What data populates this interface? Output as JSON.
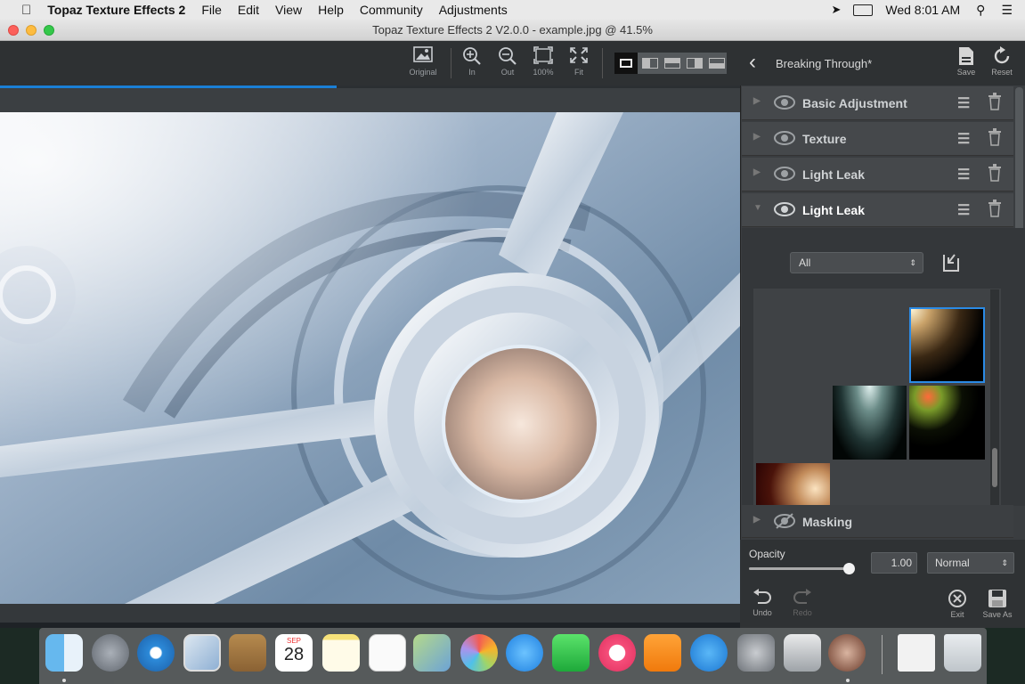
{
  "menubar": {
    "app": "Topaz Texture Effects 2",
    "items": [
      "File",
      "Edit",
      "View",
      "Help",
      "Community",
      "Adjustments"
    ],
    "clock": "Wed 8:01 AM"
  },
  "window": {
    "title": "Topaz Texture Effects 2 V2.0.0 - example.jpg @ 41.5%"
  },
  "toolbar": {
    "original": "Original",
    "zoom_in": "In",
    "zoom_out": "Out",
    "zoom_100": "100%",
    "fit": "Fit",
    "progress": 0.455
  },
  "panel": {
    "preset_title": "Breaking Through*",
    "save": "Save",
    "reset": "Reset",
    "layers": [
      {
        "name": "Basic Adjustment"
      },
      {
        "name": "Texture"
      },
      {
        "name": "Light Leak"
      },
      {
        "name": "Light Leak"
      }
    ],
    "filter_value": "All",
    "masking": "Masking",
    "opacity_label": "Opacity",
    "opacity_value": "1.00",
    "opacity_fraction": 1.0,
    "blend_mode": "Normal",
    "undo": "Undo",
    "redo": "Redo",
    "exit": "Exit",
    "save_as": "Save As"
  },
  "dock": {
    "calendar_month": "SEP",
    "calendar_day": "28"
  },
  "colors": {
    "accent": "#1a7fd6",
    "panel_bg": "#3a3d40"
  }
}
